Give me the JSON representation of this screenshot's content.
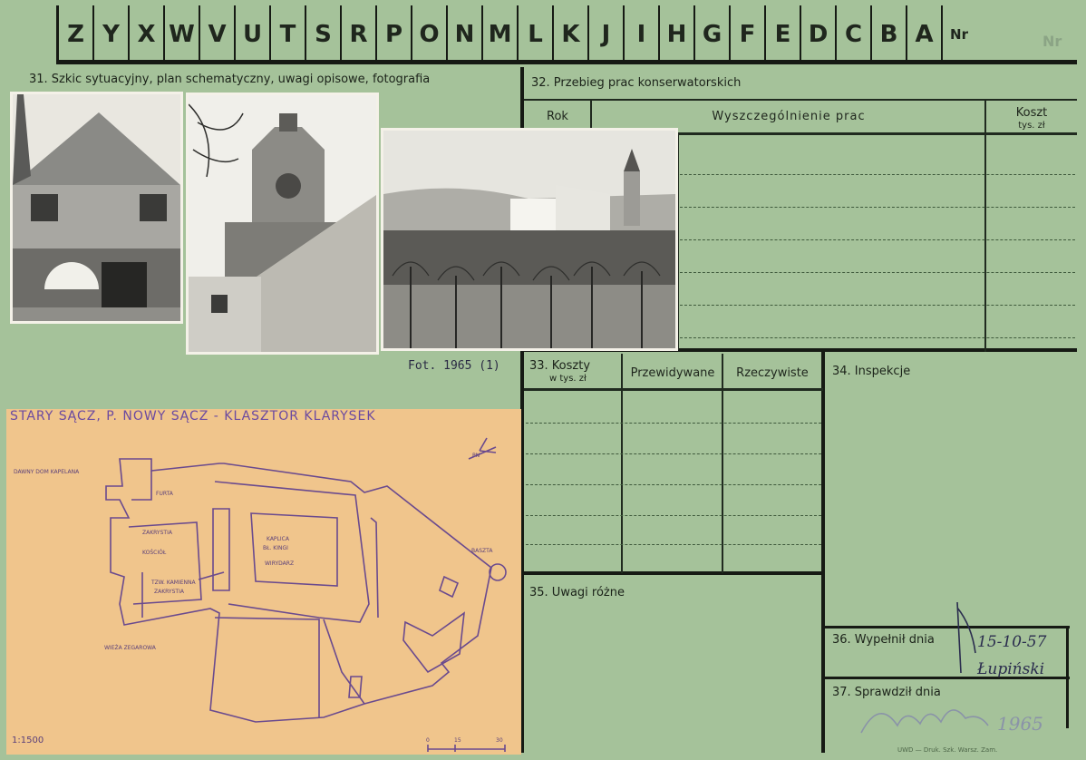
{
  "header": {
    "letters": [
      "Z",
      "Y",
      "X",
      "W",
      "V",
      "U",
      "T",
      "S",
      "R",
      "P",
      "O",
      "N",
      "M",
      "L",
      "K",
      "J",
      "I",
      "H",
      "G",
      "F",
      "E",
      "D",
      "C",
      "B",
      "A"
    ],
    "nr_label": "Nr",
    "faint_nr": "Nr"
  },
  "section31": {
    "label": "31. Szkic sytuacyjny, plan schematyczny, uwagi opisowe, fotografia"
  },
  "photo_caption": "Fot. 1965 (1)",
  "section32": {
    "label": "32. Przebieg prac konserwatorskich",
    "col_rok": "Rok",
    "col_prace": "Wyszczególnienie prac",
    "col_koszt": "Koszt",
    "col_koszt_unit": "tys. zł"
  },
  "section33": {
    "label": "33. Koszty",
    "unit": "w tys. zł",
    "col_planned": "Przewidywane",
    "col_actual": "Rzeczywiste"
  },
  "section34": {
    "label": "34. Inspekcje"
  },
  "section35": {
    "label": "35. Uwagi różne"
  },
  "section36": {
    "label": "36. Wypełnił dnia",
    "value": "15-10-57",
    "signature": "Łupiński"
  },
  "section37": {
    "label": "37. Sprawdził dnia",
    "value": "1965"
  },
  "plan": {
    "title": "STARY SĄCZ, P. NOWY SĄCZ - KLASZTOR KLARYSEK",
    "scale": "1:1500",
    "labels": {
      "dom": "DAWNY DOM KAPELANA",
      "furta": "FURTA",
      "zakrystia": "ZAKRYSTIA",
      "kosciol": "KOŚCIÓŁ",
      "kaplica": "KAPLICA",
      "kaplica2": "BŁ. KINGI",
      "wirydarz": "WIRYDARZ",
      "kamienna": "TZW. KAMIENNA",
      "zakrystia2": "ZAKRYSTIA",
      "wieza": "WIEŻA ZEGAROWA",
      "baszta": "BASZTA",
      "north": "PN",
      "ticks": [
        "0",
        "15",
        "30"
      ]
    }
  },
  "footer_stamp": "UWD — Druk. Szk. Warsz. Zam."
}
